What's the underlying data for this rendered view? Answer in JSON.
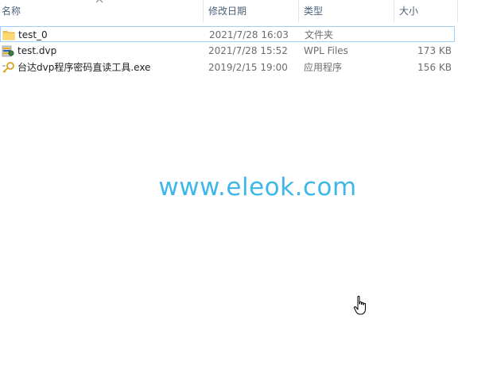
{
  "columns": {
    "name": "名称",
    "date": "修改日期",
    "type": "类型",
    "size": "大小"
  },
  "files": [
    {
      "name": "test_0",
      "date": "2021/7/28 16:03",
      "type": "文件夹",
      "size": "",
      "icon": "folder-icon",
      "selected": true
    },
    {
      "name": "test.dvp",
      "date": "2021/7/28 15:52",
      "type": "WPL Files",
      "size": "173 KB",
      "icon": "dvp-file-icon",
      "selected": false
    },
    {
      "name": "台达dvp程序密码直读工具.exe",
      "date": "2019/2/15 19:00",
      "type": "应用程序",
      "size": "156 KB",
      "icon": "key-exe-icon",
      "selected": false
    }
  ],
  "watermark": "www.eleok.com",
  "colors": {
    "header_text": "#4c607a",
    "selection_border": "#99d1ff",
    "watermark": "#3fb7ea",
    "folder": "#f5c95c"
  },
  "cursor": "hand-pointer-icon"
}
